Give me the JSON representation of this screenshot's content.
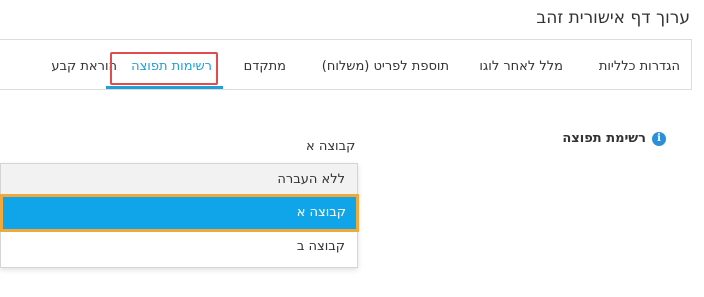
{
  "window": {
    "title": "ערוך דף אישורית זהב"
  },
  "tabs": [
    {
      "label": "הגדרות כלליות"
    },
    {
      "label": "מלל לאחר לוגו"
    },
    {
      "label": "תוספת לפריט (משלוח)"
    },
    {
      "label": "מתקדם"
    },
    {
      "label": "רשימות תפוצה"
    },
    {
      "label": "הוראת קבע"
    }
  ],
  "active_tab": "רשימות תפוצה",
  "form": {
    "mailing_list_label": "רשימת תפוצה",
    "info_icon": "info-circle-icon",
    "selected_value": "קבוצה א"
  },
  "dropdown": {
    "options": [
      {
        "label": "ללא העברה"
      },
      {
        "label": "קבוצה א"
      },
      {
        "label": "קבוצה ב"
      }
    ]
  },
  "colors": {
    "accent": "#1da1d8",
    "selected_option_bg": "#10a5e8",
    "highlight_red": "#e24c4c",
    "highlight_orange": "#f2a93b"
  }
}
